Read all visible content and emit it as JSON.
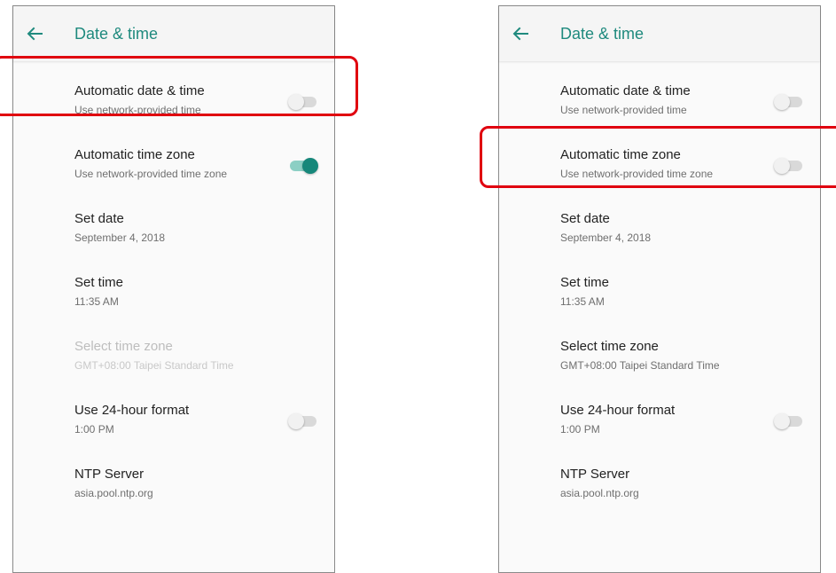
{
  "accent_color": "#1f8a7e",
  "highlight_color": "#e0000f",
  "screens": [
    {
      "back_icon": "arrow-left-icon",
      "title": "Date & time",
      "items": [
        {
          "title": "Automatic date & time",
          "summary": "Use network-provided time",
          "switch": "off",
          "enabled": true
        },
        {
          "title": "Automatic time zone",
          "summary": "Use network-provided time zone",
          "switch": "on",
          "enabled": true
        },
        {
          "title": "Set date",
          "summary": "September 4, 2018",
          "enabled": true
        },
        {
          "title": "Set time",
          "summary": "11:35 AM",
          "enabled": true
        },
        {
          "title": "Select time zone",
          "summary": "GMT+08:00 Taipei Standard Time",
          "enabled": false
        },
        {
          "title": "Use 24-hour format",
          "summary": "1:00 PM",
          "switch": "off",
          "enabled": true
        },
        {
          "title": "NTP Server",
          "summary": "asia.pool.ntp.org",
          "enabled": true
        }
      ],
      "highlighted_item": "Automatic date & time"
    },
    {
      "back_icon": "arrow-left-icon",
      "title": "Date & time",
      "items": [
        {
          "title": "Automatic date & time",
          "summary": "Use network-provided time",
          "switch": "off",
          "enabled": true
        },
        {
          "title": "Automatic time zone",
          "summary": "Use network-provided time zone",
          "switch": "off",
          "enabled": true
        },
        {
          "title": "Set date",
          "summary": "September 4, 2018",
          "enabled": true
        },
        {
          "title": "Set time",
          "summary": "11:35 AM",
          "enabled": true
        },
        {
          "title": "Select time zone",
          "summary": "GMT+08:00 Taipei Standard Time",
          "enabled": true
        },
        {
          "title": "Use 24-hour format",
          "summary": "1:00 PM",
          "switch": "off",
          "enabled": true
        },
        {
          "title": "NTP Server",
          "summary": "asia.pool.ntp.org",
          "enabled": true
        }
      ],
      "highlighted_item": "Automatic time zone"
    }
  ]
}
